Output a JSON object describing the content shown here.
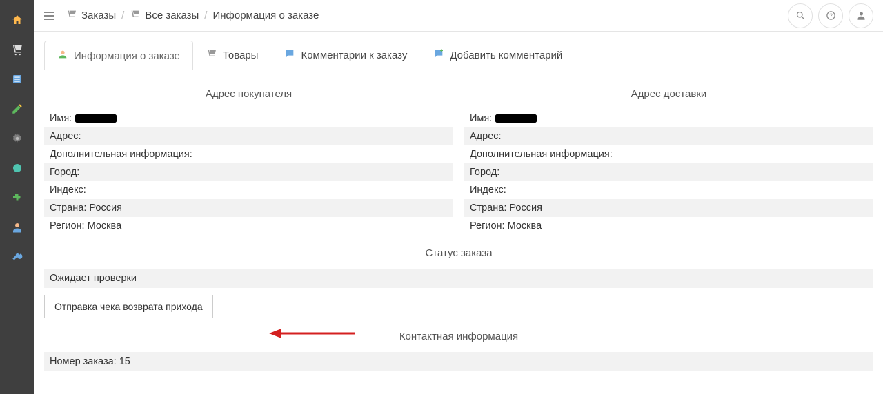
{
  "breadcrumb": {
    "orders": "Заказы",
    "all_orders": "Все заказы",
    "order_info": "Информация о заказе"
  },
  "tabs": {
    "info": "Информация о заказе",
    "products": "Товары",
    "comments": "Комментарии к заказу",
    "add_comment": "Добавить комментарий"
  },
  "buyer": {
    "title": "Адрес покупателя",
    "name_label": "Имя:",
    "name_value": "",
    "address_label": "Адрес:",
    "address_value": "",
    "addinfo_label": "Дополнительная информация:",
    "addinfo_value": "",
    "city_label": "Город:",
    "city_value": "",
    "index_label": "Индекс:",
    "index_value": "",
    "country_label": "Страна:",
    "country_value": "Россия",
    "region_label": "Регион:",
    "region_value": "Москва"
  },
  "shipping": {
    "title": "Адрес доставки",
    "name_label": "Имя:",
    "name_value": "",
    "address_label": "Адрес:",
    "address_value": "",
    "addinfo_label": "Дополнительная информация:",
    "addinfo_value": "",
    "city_label": "Город:",
    "city_value": "",
    "index_label": "Индекс:",
    "index_value": "",
    "country_label": "Страна:",
    "country_value": "Россия",
    "region_label": "Регион:",
    "region_value": "Москва"
  },
  "status": {
    "title": "Статус заказа",
    "value": "Ожидает проверки",
    "action_button": "Отправка чека возврата прихода"
  },
  "contact": {
    "title": "Контактная информация",
    "order_num_label": "Номер заказа:",
    "order_num_value": "15"
  }
}
